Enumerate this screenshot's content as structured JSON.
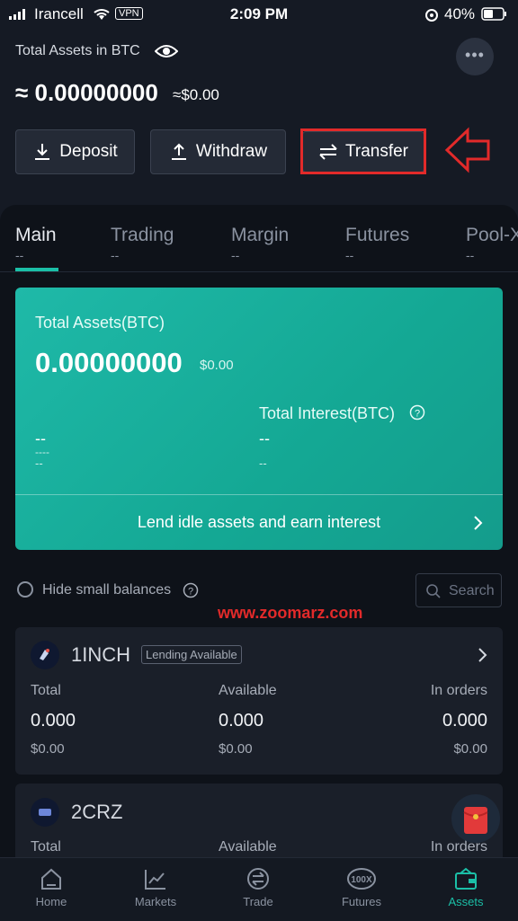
{
  "status": {
    "carrier": "Irancell",
    "vpn": "VPN",
    "time": "2:09 PM",
    "battery": "40%"
  },
  "header": {
    "label": "Total Assets in BTC",
    "value": "≈ 0.00000000",
    "usd": "≈$0.00",
    "more": "•••",
    "buttons": {
      "deposit": "Deposit",
      "withdraw": "Withdraw",
      "transfer": "Transfer"
    }
  },
  "tabs": [
    {
      "label": "Main",
      "sub": "--"
    },
    {
      "label": "Trading",
      "sub": "--"
    },
    {
      "label": "Margin",
      "sub": "--"
    },
    {
      "label": "Futures",
      "sub": "--"
    },
    {
      "label": "Pool-X",
      "sub": "--"
    }
  ],
  "card": {
    "total_label": "Total Assets(BTC)",
    "total_value": "0.00000000",
    "total_usd": "$0.00",
    "interest_label": "Total Interest(BTC)",
    "left_a": "--",
    "left_b": "----",
    "left_c": "--",
    "right_a": "--",
    "right_b": "--",
    "lend_text": "Lend idle assets and earn interest"
  },
  "filters": {
    "hide_small": "Hide small balances",
    "search_placeholder": "Search"
  },
  "watermark": "www.zoomarz.com",
  "assets": [
    {
      "symbol": "1INCH",
      "badge": "Lending Available",
      "total_label": "Total",
      "available_label": "Available",
      "orders_label": "In orders",
      "total": "0.000",
      "available": "0.000",
      "orders": "0.000",
      "total_usd": "$0.00",
      "available_usd": "$0.00",
      "orders_usd": "$0.00"
    },
    {
      "symbol": "2CRZ",
      "total_label": "Total",
      "available_label": "Available",
      "orders_label": "In orders"
    }
  ],
  "nav": [
    {
      "label": "Home"
    },
    {
      "label": "Markets"
    },
    {
      "label": "Trade"
    },
    {
      "label": "Futures",
      "icon_text": "100X"
    },
    {
      "label": "Assets"
    }
  ],
  "colors": {
    "accent": "#1bbfa7",
    "highlight": "#e22a2a",
    "background": "#151a24"
  }
}
